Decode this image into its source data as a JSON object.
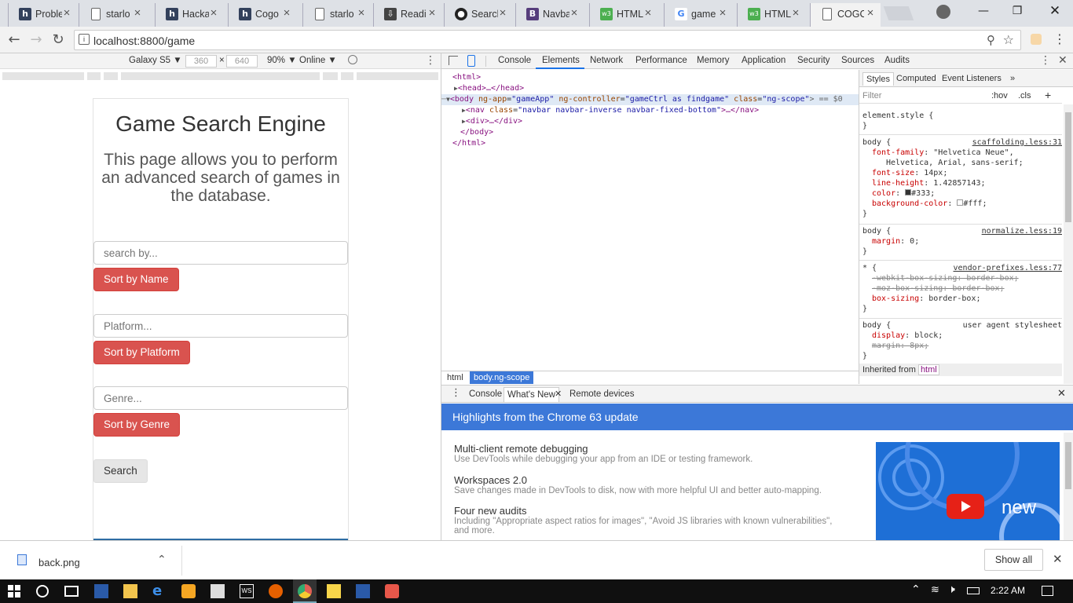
{
  "tabs": [
    {
      "icon": "h",
      "title": "Proble"
    },
    {
      "icon": "doc",
      "title": "starlo"
    },
    {
      "icon": "h",
      "title": "Hacka"
    },
    {
      "icon": "h",
      "title": "Cogo"
    },
    {
      "icon": "doc",
      "title": "starlo"
    },
    {
      "icon": "dl",
      "title": "Readi"
    },
    {
      "icon": "gh",
      "title": "Searcl"
    },
    {
      "icon": "b",
      "title": "Navba"
    },
    {
      "icon": "w3",
      "title": "HTML"
    },
    {
      "icon": "g",
      "title": "game"
    },
    {
      "icon": "w3",
      "title": "HTML"
    },
    {
      "icon": "doc",
      "title": "COGC"
    }
  ],
  "address": {
    "url": "localhost:8800/game"
  },
  "device_toolbar": {
    "device": "Galaxy S5 ▼",
    "width": "360",
    "x": "×",
    "height": "640",
    "zoom": "90% ▼",
    "network": "Online ▼"
  },
  "page": {
    "title": "Game Search Engine",
    "subtitle": "This page allows you to perform an advanced search of games in the database.",
    "search_placeholder": "search by...",
    "sort_name": "Sort by Name",
    "platform_placeholder": "Platform...",
    "sort_platform": "Sort by Platform",
    "genre_placeholder": "Genre...",
    "sort_genre": "Sort by Genre",
    "search_btn": "Search"
  },
  "devtools": {
    "tabs": [
      "Console",
      "Elements",
      "Network",
      "Performance",
      "Memory",
      "Application",
      "Security",
      "Sources",
      "Audits"
    ],
    "dom": {
      "html_open": "<html>",
      "head": "<head>…</head>",
      "body_tag": "<body",
      "body_a1": "ng-app",
      "body_v1": "\"gameApp\"",
      "body_a2": "ng-controller",
      "body_v2": "\"gameCtrl as findgame\"",
      "body_a3": "class",
      "body_v3": "\"ng-scope\"",
      "body_eq": "> == $0",
      "nav_tag": "<nav",
      "nav_attr": "class",
      "nav_val": "\"navbar navbar-inverse navbar-fixed-bottom\"",
      "nav_end": ">…</nav>",
      "div": "<div>…</div>",
      "body_close": "</body>",
      "html_close": "</html>"
    },
    "breadcrumbs": [
      "html",
      "body.ng-scope"
    ],
    "styles_tabs": [
      "Styles",
      "Computed",
      "Event Listeners",
      "»"
    ],
    "filter": "Filter",
    "hov": ":hov",
    "cls": ".cls",
    "plus": "+",
    "rules": [
      {
        "selector": "element.style {",
        "source": ""
      },
      {
        "selector": "body {",
        "source": "scaffolding.less:31"
      },
      {
        "selector": "body {",
        "source": "normalize.less:19"
      },
      {
        "selector": "* {",
        "source": "vendor-prefixes.less:77"
      },
      {
        "selector": "body {",
        "source": "user agent stylesheet"
      }
    ],
    "props": {
      "ff_name": "font-family",
      "ff_val": "\"Helvetica Neue\",",
      "ff_val2": "Helvetica, Arial, sans-serif;",
      "fs_name": "font-size",
      "fs_val": "14px;",
      "lh_name": "line-height",
      "lh_val": "1.42857143;",
      "color_name": "color",
      "color_val": "#333;",
      "bg_name": "background-color",
      "bg_val": "#fff;",
      "margin_name": "margin",
      "margin_val": "0;",
      "wk": "-webkit-box-sizing: border-box;",
      "moz": "-moz-box-sizing: border-box;",
      "bs_name": "box-sizing",
      "bs_val": "border-box;",
      "disp_name": "display",
      "disp_val": "block;",
      "um_name": "margin",
      "um_val": "8px;",
      "close": "}"
    },
    "inherited": "Inherited from",
    "inherited_tag": "html",
    "drawer_tabs": [
      "Console",
      "What's New",
      "Remote devices"
    ],
    "whats_new": "Highlights from the Chrome 63 update",
    "highlights": [
      {
        "h": "Multi-client remote debugging",
        "d": "Use DevTools while debugging your app from an IDE or testing framework."
      },
      {
        "h": "Workspaces 2.0",
        "d": "Save changes made in DevTools to disk, now with more helpful UI and better auto-mapping."
      },
      {
        "h": "Four new audits",
        "d": "Including \"Appropriate aspect ratios for images\", \"Avoid JS libraries with known vulnerabilities\", and more."
      }
    ],
    "promo_text": "new"
  },
  "download": {
    "file": "back.png",
    "show_all": "Show all"
  },
  "taskbar": {
    "time": "2:22 AM"
  },
  "colors": {
    "accent": "#d9534f",
    "devtools_blue": "#3c78d8",
    "selection": "#1a73e8"
  }
}
